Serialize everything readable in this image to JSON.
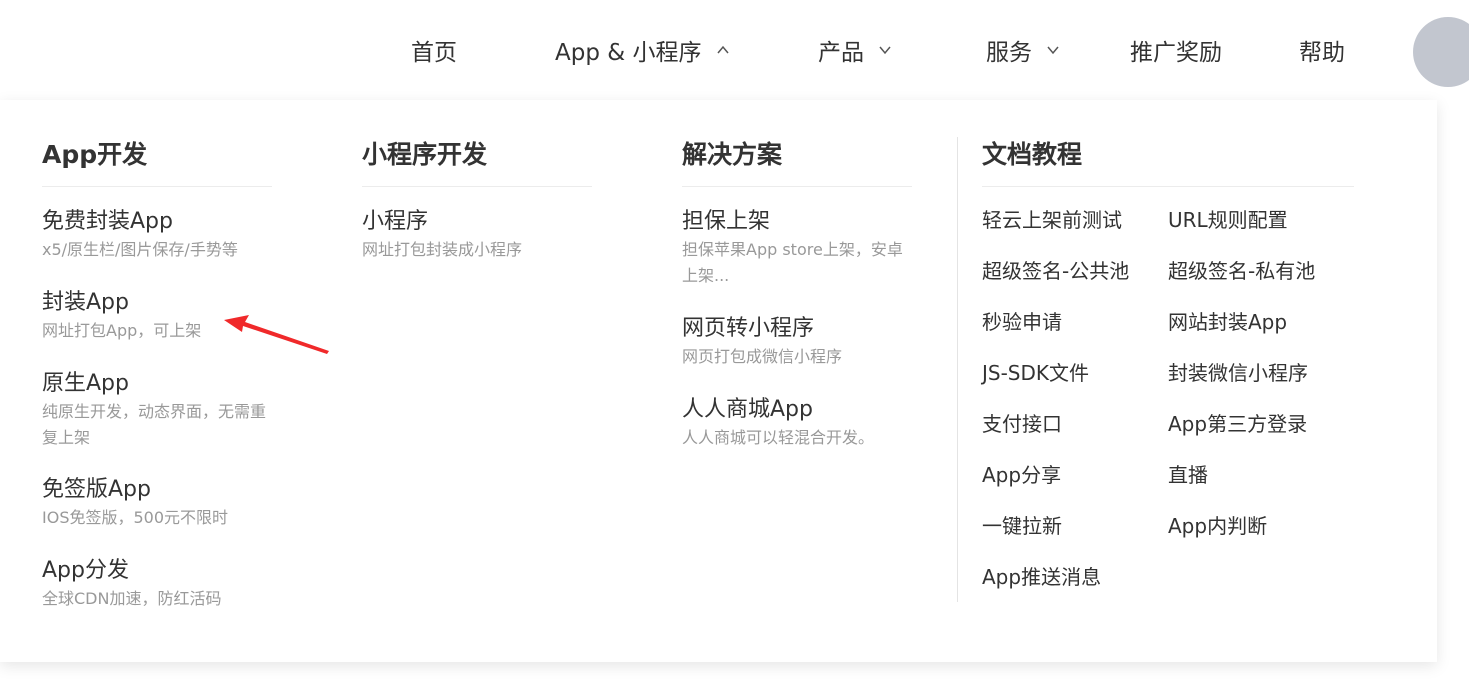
{
  "nav": {
    "items": [
      {
        "label": "首页"
      },
      {
        "label": "App & 小程序"
      },
      {
        "label": "产品"
      },
      {
        "label": "服务"
      },
      {
        "label": "推广奖励"
      },
      {
        "label": "帮助"
      }
    ]
  },
  "dropdown": {
    "app_dev": {
      "title": "App开发",
      "items": [
        {
          "title": "免费封装App",
          "desc": "x5/原生栏/图片保存/手势等"
        },
        {
          "title": "封装App",
          "desc": "网址打包App，可上架"
        },
        {
          "title": "原生App",
          "desc": "纯原生开发，动态界面，无需重复上架"
        },
        {
          "title": "免签版App",
          "desc": "IOS免签版，500元不限时"
        },
        {
          "title": "App分发",
          "desc": "全球CDN加速，防红活码"
        }
      ]
    },
    "mini_dev": {
      "title": "小程序开发",
      "items": [
        {
          "title": "小程序",
          "desc": "网址打包封装成小程序"
        }
      ]
    },
    "solutions": {
      "title": "解决方案",
      "items": [
        {
          "title": "担保上架",
          "desc": "担保苹果App store上架，安卓上架..."
        },
        {
          "title": "网页转小程序",
          "desc": "网页打包成微信小程序"
        },
        {
          "title": "人人商城App",
          "desc": "人人商城可以轻混合开发。"
        }
      ]
    },
    "docs": {
      "title": "文档教程",
      "links": [
        "轻云上架前测试",
        "URL规则配置",
        "超级签名-公共池",
        "超级签名-私有池",
        "秒验申请",
        "网站封装App",
        "JS-SDK文件",
        "封装微信小程序",
        "支付接口",
        "App第三方登录",
        "App分享",
        "直播",
        "一键拉新",
        "App内判断",
        "App推送消息"
      ]
    }
  },
  "colors": {
    "text": "#333333",
    "muted": "#999999",
    "annotation": "#f0292a",
    "avatar": "#c2c6cf"
  }
}
